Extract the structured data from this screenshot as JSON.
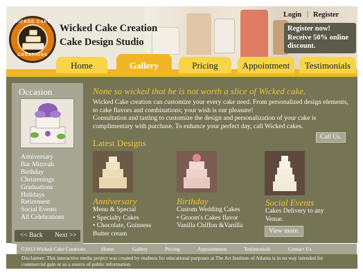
{
  "brand": {
    "name": "Wicked Cake Creation",
    "tagline": "Cake Design Studio",
    "logo_top": "WICKED CAKE",
    "logo_bottom": "CREATIONS"
  },
  "account": {
    "login": "Login",
    "separator": "|",
    "register": "Register"
  },
  "promo": {
    "line1": "Register now!",
    "line2": "Receive 50% online",
    "line3": "discount."
  },
  "nav": {
    "home": "Home",
    "gallery": "Gallery",
    "pricing": "Pricing",
    "appointment": "Appointment",
    "testimonials": "Testimonials"
  },
  "sidebar": {
    "title": "Occasion",
    "items": [
      "Anniversary",
      "Bar Mitzvah",
      "Birthday",
      "Christenings",
      "Graduations",
      "Holidays",
      "Retirement",
      "Social Events",
      "All Celebrations"
    ],
    "prev": "<< Back",
    "next": "Next >>"
  },
  "content": {
    "tagline": "None so wicked that he is not worth a slice of Wicked cake.",
    "intro1": "Wicked Cake creation can customize your every cake need. From personalized design elements, to cake flavors and combinations; your wish is our pleasure!",
    "intro2": "Consultation and tasting to customize the design and personalization of your cake is complimentary with purchase. To enhance your perfect day, call Wicked cakes.",
    "call_button": "Call Us.",
    "latest_title": "Latest Designs",
    "more_button": "View more."
  },
  "designs": [
    {
      "title": "Anniversary",
      "lines": [
        "Menu & Special",
        "•  Specialty Cakes",
        "•  Chocolate, Guinness",
        "Butter cream"
      ]
    },
    {
      "title": "Birthday",
      "lines": [
        "Custom Wedding Cakes",
        "•  Groom's Cakes flavor",
        "Vanilla Chiffon &Vanilla"
      ]
    },
    {
      "title": "Social Events",
      "lines": [
        "Cakes Delivery to any",
        "Venue."
      ]
    }
  ],
  "footer": {
    "copyright": "©2013 Wicked Cake Creations",
    "links": [
      "Home",
      "Gallery",
      "Pricing",
      "Appointments",
      "Testimonials",
      "Contact Us"
    ],
    "disclaimer": "Disclaimer: This interactive media project was created by students for educational purposes at The Art Institute of Atlanta is in no way intended for commercial gain or as a source of public information."
  },
  "colors": {
    "olive_panel": "#757454",
    "sidebar_gray": "#a6a693",
    "nav_yellow": "#f7d54a",
    "nav_gold": "#f0b625",
    "headline_gold": "#f0c53a",
    "promo_box": "#5b5a4b"
  }
}
